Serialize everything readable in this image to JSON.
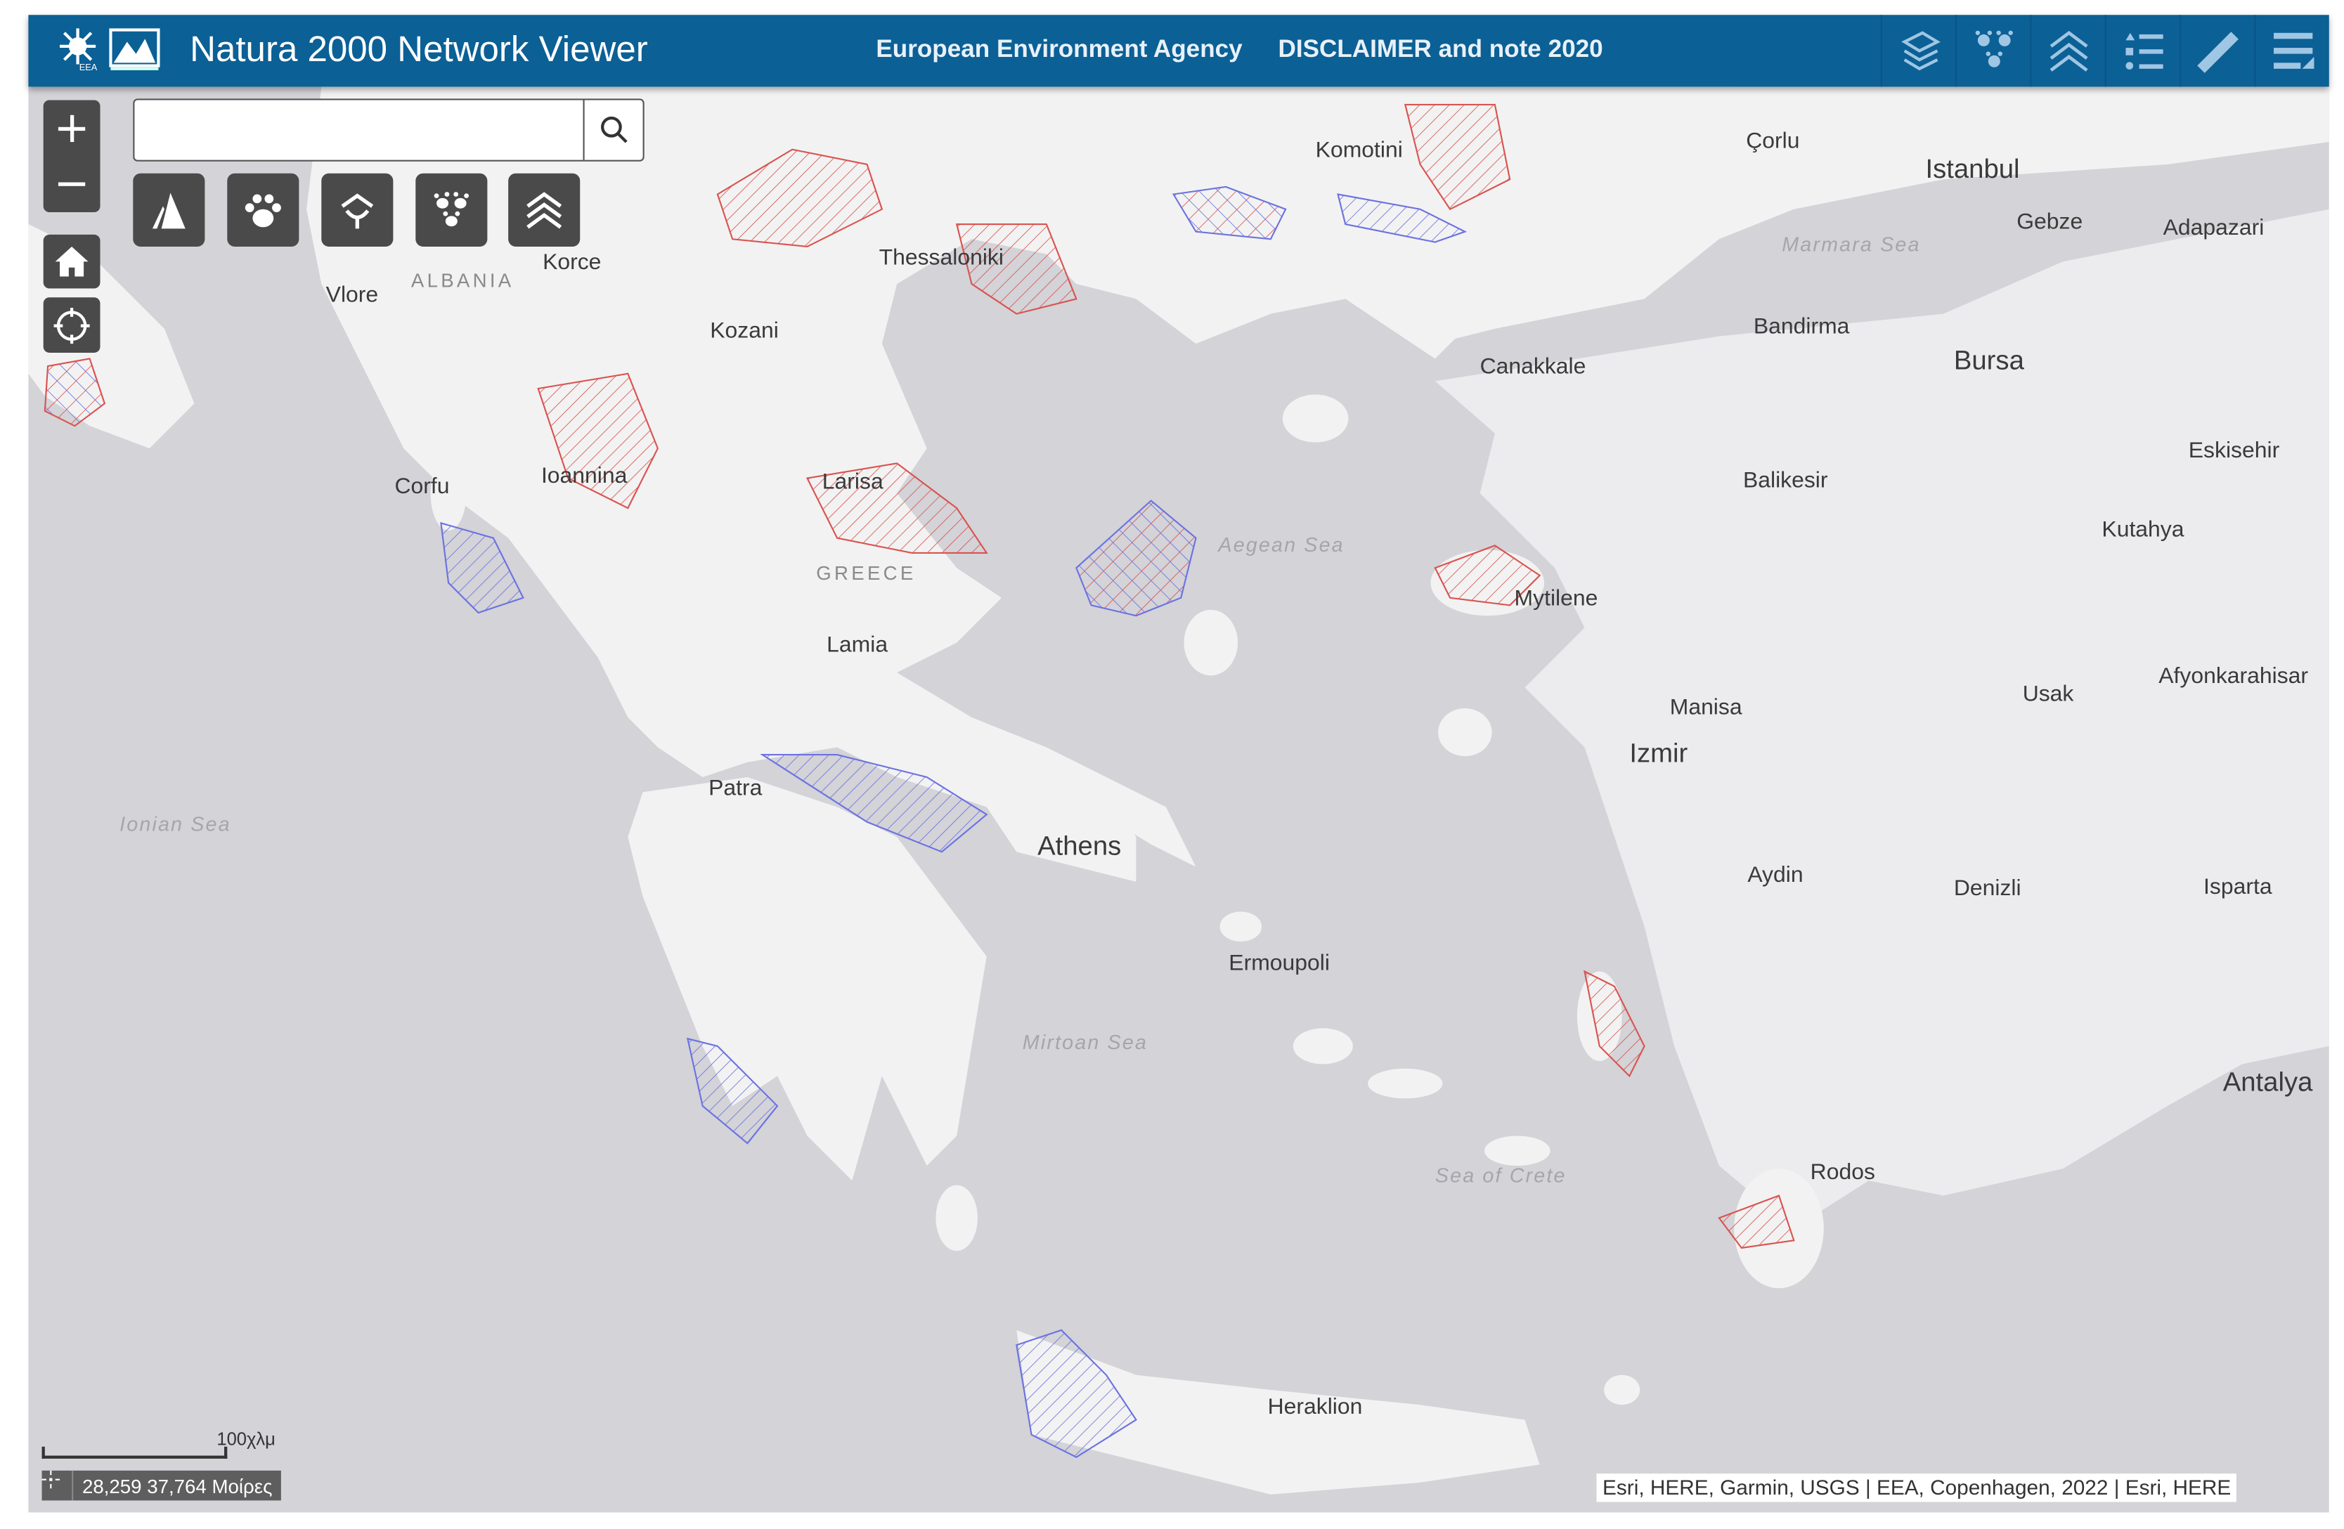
{
  "header": {
    "title": "Natura 2000 Network Viewer",
    "links": [
      "European Environment Agency",
      "DISCLAIMER and note 2020"
    ],
    "logos": [
      "EEA",
      "Natura 2000"
    ],
    "tools": [
      {
        "icon": "layers-icon",
        "name": "layers"
      },
      {
        "icon": "species-icon",
        "name": "species"
      },
      {
        "icon": "habitats-icon",
        "name": "habitats"
      },
      {
        "icon": "legend-icon",
        "name": "legend"
      },
      {
        "icon": "measure-icon",
        "name": "measure"
      },
      {
        "icon": "menu-icon",
        "name": "menu"
      }
    ],
    "color": "#0b6096"
  },
  "search": {
    "value": "",
    "placeholder": ""
  },
  "toolbar": [
    {
      "icon": "sites-icon"
    },
    {
      "icon": "paw-icon"
    },
    {
      "icon": "habitat-hand-icon"
    },
    {
      "icon": "multi-paw-icon"
    },
    {
      "icon": "chevrons-icon"
    }
  ],
  "map": {
    "labels": [
      "Komotini",
      "Çorlu",
      "Istanbul",
      "Gebze",
      "Adapazari",
      "Marmara Sea",
      "Thessaloniki",
      "Korce",
      "ALBANIA",
      "Vlore",
      "Kozani",
      "Bandirma",
      "Canakkale",
      "Bursa",
      "Eskisehir",
      "Balikesir",
      "Corfu",
      "Ioannina",
      "Larisa",
      "Kutahya",
      "Aegean Sea",
      "GREECE",
      "Mytilene",
      "Lamia",
      "Manisa",
      "Usak",
      "Afyonkarahisar",
      "Izmir",
      "Patra",
      "Ionian Sea",
      "Athens",
      "Aydin",
      "Denizli",
      "Isparta",
      "Ermoupoli",
      "Mirtoan Sea",
      "Antalya",
      "Sea of Crete",
      "Rodos",
      "Heraklion"
    ],
    "colors": {
      "sea": "#d3d3d8",
      "land": "#f2f2f2",
      "sci": "#d9534f",
      "spa": "#6b72e0"
    }
  },
  "scale_bar": {
    "label": "100χλμ"
  },
  "coordinates": {
    "text": "28,259 37,764 Μοίρες"
  },
  "attribution": "Esri, HERE, Garmin, USGS | EEA, Copenhagen, 2022 | Esri, HERE"
}
